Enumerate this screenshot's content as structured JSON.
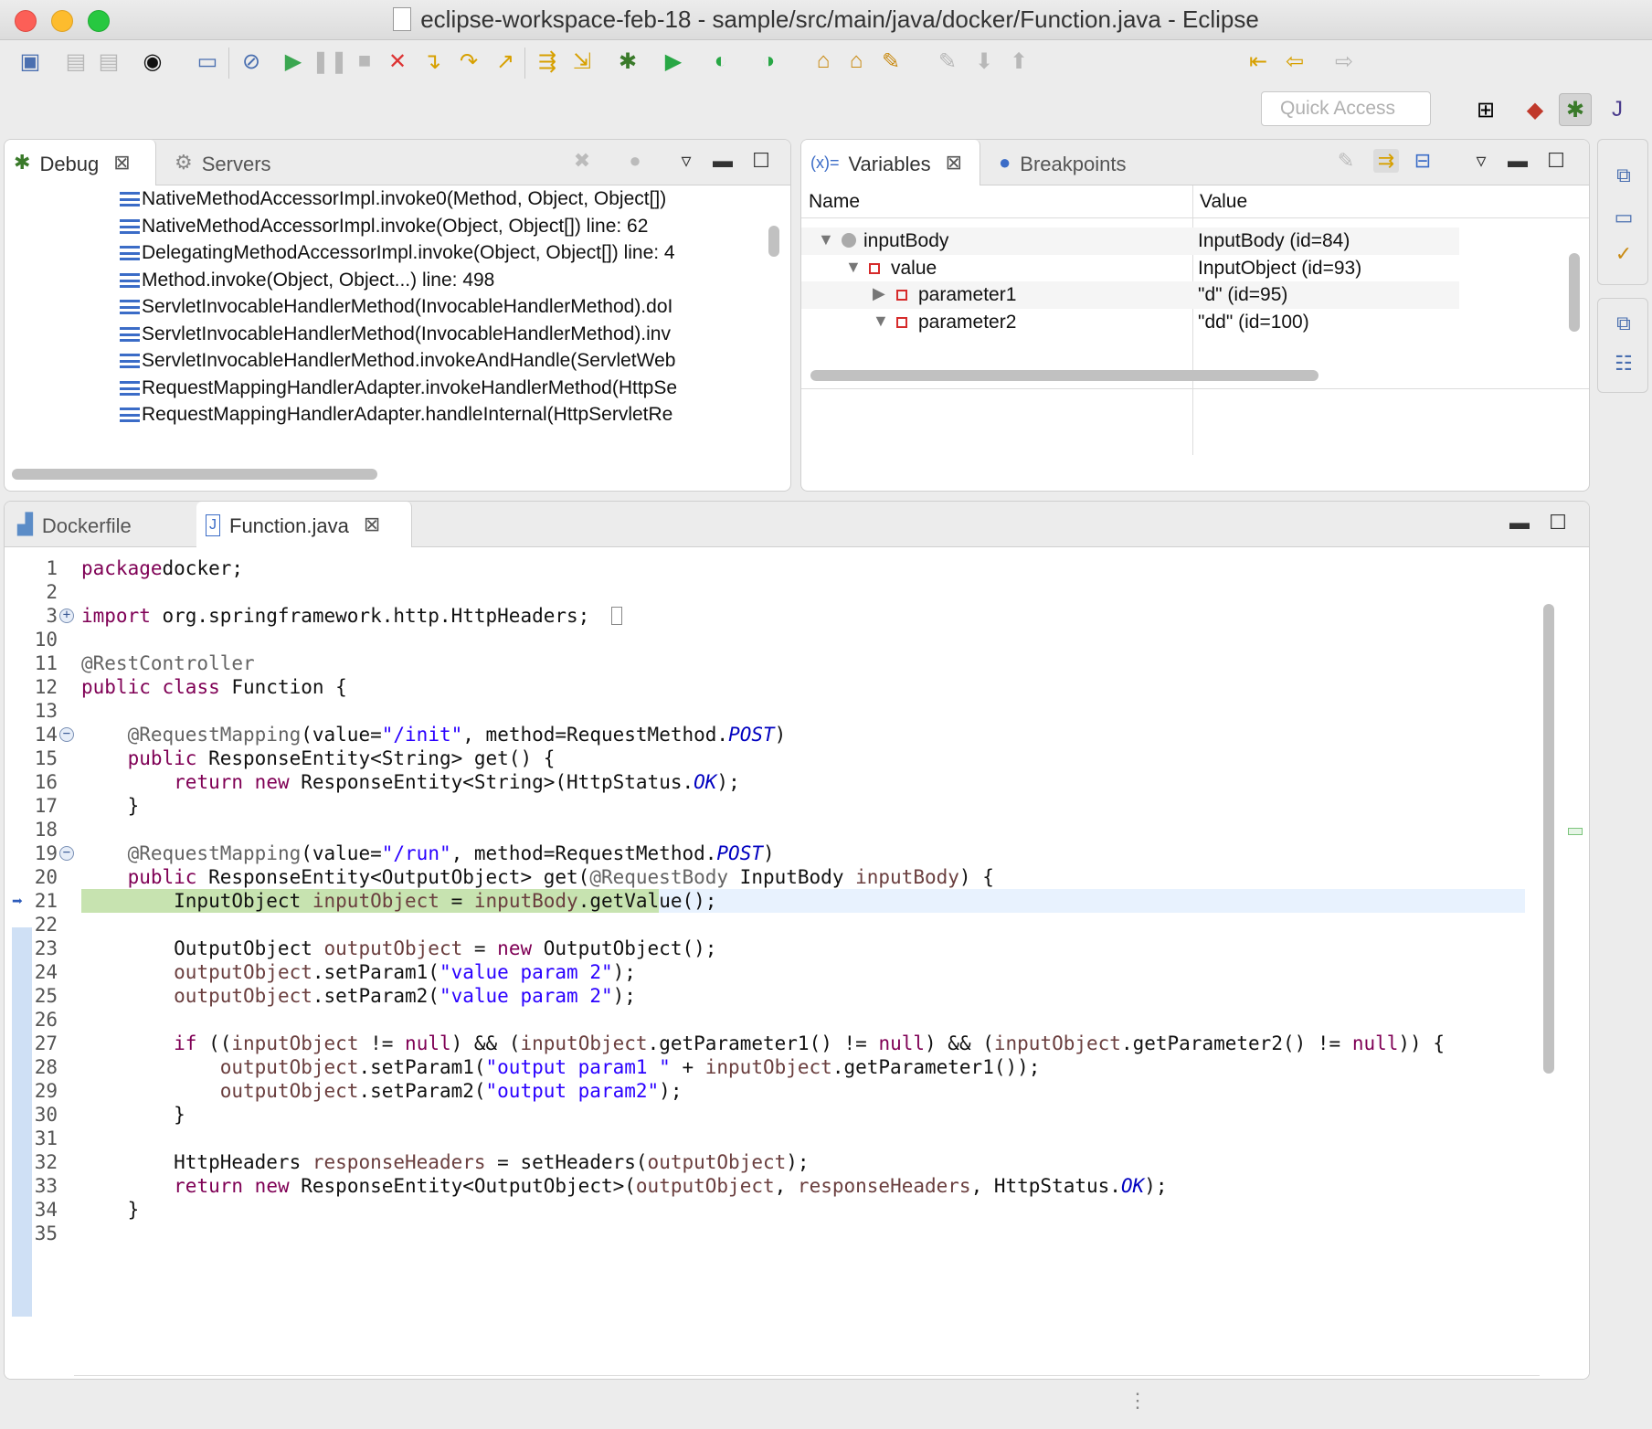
{
  "window": {
    "title": "eclipse-workspace-feb-18 - sample/src/main/java/docker/Function.java - Eclipse"
  },
  "toolbar": {
    "quick_access_placeholder": "Quick Access",
    "icons": [
      "new-wizard-icon",
      "save-icon",
      "save-all-icon",
      "profile-icon",
      "console-icon",
      "skip-breakpoints-icon",
      "resume-icon",
      "suspend-icon",
      "terminate-icon",
      "disconnect-icon",
      "step-into-icon",
      "step-over-icon",
      "step-return-icon",
      "drop-to-frame-icon",
      "use-step-filters-icon",
      "debug-icon",
      "run-icon",
      "coverage-icon",
      "external-tools-icon",
      "open-type-icon",
      "open-task-icon",
      "search-icon",
      "toggle-mark-occurrences-icon",
      "next-annotation-icon",
      "previous-annotation-icon",
      "last-edit-icon",
      "back-icon",
      "forward-icon"
    ],
    "perspectives": [
      "open-perspective-icon",
      "java-ee-perspective-icon",
      "debug-perspective-icon",
      "java-perspective-icon"
    ]
  },
  "debug_view": {
    "tabs": [
      {
        "label": "Debug",
        "icon": "bug-icon",
        "active": true
      },
      {
        "label": "Servers",
        "icon": "servers-icon",
        "active": false
      }
    ],
    "frames": [
      "NativeMethodAccessorImpl.invoke0(Method, Object, Object[])",
      "NativeMethodAccessorImpl.invoke(Object, Object[]) line: 62",
      "DelegatingMethodAccessorImpl.invoke(Object, Object[]) line: 4",
      "Method.invoke(Object, Object...) line: 498",
      "ServletInvocableHandlerMethod(InvocableHandlerMethod).doI",
      "ServletInvocableHandlerMethod(InvocableHandlerMethod).inv",
      "ServletInvocableHandlerMethod.invokeAndHandle(ServletWeb",
      "RequestMappingHandlerAdapter.invokeHandlerMethod(HttpSe",
      "RequestMappingHandlerAdapter.handleInternal(HttpServletRe"
    ]
  },
  "variables_view": {
    "tabs": [
      {
        "label": "Variables",
        "icon": "variables-icon",
        "active": true
      },
      {
        "label": "Breakpoints",
        "icon": "breakpoints-icon",
        "active": false
      }
    ],
    "columns": [
      "Name",
      "Value"
    ],
    "rows": [
      {
        "name": "inputBody",
        "value": "InputBody  (id=84)",
        "expanded": true,
        "icon": "local-variable-icon"
      },
      {
        "name": "value",
        "value": "InputObject  (id=93)",
        "expanded": true,
        "icon": "private-field-icon"
      },
      {
        "name": "parameter1",
        "value": "\"d\" (id=95)",
        "expanded": false,
        "icon": "private-field-icon"
      },
      {
        "name": "parameter2",
        "value": "\"dd\" (id=100)",
        "expanded": true,
        "icon": "private-field-icon"
      }
    ]
  },
  "editor": {
    "tabs": [
      {
        "label": "Dockerfile",
        "icon": "dockerfile-icon",
        "active": false
      },
      {
        "label": "Function.java",
        "icon": "java-file-icon",
        "active": true
      }
    ],
    "current_line": "21",
    "lines": [
      {
        "n": "1",
        "code": [
          [
            "kw",
            "package"
          ],
          [
            "",
            "docker;"
          ]
        ]
      },
      {
        "n": "2",
        "code": []
      },
      {
        "n": "3",
        "code": [
          [
            "kw",
            "import"
          ],
          [
            "",
            " org.springframework.http.HttpHeaders;"
          ]
        ]
      },
      {
        "n": "10",
        "code": []
      },
      {
        "n": "11",
        "code": [
          [
            "ann",
            "@RestController"
          ]
        ]
      },
      {
        "n": "12",
        "code": [
          [
            "kw",
            "public"
          ],
          [
            "",
            " "
          ],
          [
            "kw",
            "class"
          ],
          [
            "",
            " Function {"
          ]
        ]
      },
      {
        "n": "13",
        "code": []
      },
      {
        "n": "14",
        "code": [
          [
            "",
            "    "
          ],
          [
            "ann",
            "@RequestMapping"
          ],
          [
            "",
            "(value="
          ],
          [
            "str",
            "\"/init\""
          ],
          [
            "",
            ", method=RequestMethod."
          ],
          [
            "const",
            "POST"
          ],
          [
            "",
            ")"
          ]
        ]
      },
      {
        "n": "15",
        "code": [
          [
            "",
            "    "
          ],
          [
            "kw",
            "public"
          ],
          [
            "",
            " ResponseEntity<String> get() {"
          ]
        ]
      },
      {
        "n": "16",
        "code": [
          [
            "",
            "        "
          ],
          [
            "kw",
            "return"
          ],
          [
            "",
            " "
          ],
          [
            "kw",
            "new"
          ],
          [
            "",
            " ResponseEntity<String>(HttpStatus."
          ],
          [
            "const",
            "OK"
          ],
          [
            "",
            ");"
          ]
        ]
      },
      {
        "n": "17",
        "code": [
          [
            "",
            "    }"
          ]
        ]
      },
      {
        "n": "18",
        "code": []
      },
      {
        "n": "19",
        "code": [
          [
            "",
            "    "
          ],
          [
            "ann",
            "@RequestMapping"
          ],
          [
            "",
            "(value="
          ],
          [
            "str",
            "\"/run\""
          ],
          [
            "",
            ", method=RequestMethod."
          ],
          [
            "const",
            "POST"
          ],
          [
            "",
            ")"
          ]
        ]
      },
      {
        "n": "20",
        "code": [
          [
            "",
            "    "
          ],
          [
            "kw",
            "public"
          ],
          [
            "",
            " ResponseEntity<OutputObject> get("
          ],
          [
            "ann",
            "@RequestBody"
          ],
          [
            "",
            " InputBody "
          ],
          [
            "var",
            "inputBody"
          ],
          [
            "",
            ") {"
          ]
        ]
      },
      {
        "n": "21",
        "code": [
          [
            "",
            "        InputObject "
          ],
          [
            "var",
            "inputObject"
          ],
          [
            "",
            " = "
          ],
          [
            "var",
            "inputBody"
          ],
          [
            "",
            ".getValue();"
          ]
        ]
      },
      {
        "n": "22",
        "code": []
      },
      {
        "n": "23",
        "code": [
          [
            "",
            "        OutputObject "
          ],
          [
            "var",
            "outputObject"
          ],
          [
            "",
            " = "
          ],
          [
            "kw",
            "new"
          ],
          [
            "",
            " OutputObject();"
          ]
        ]
      },
      {
        "n": "24",
        "code": [
          [
            "",
            "        "
          ],
          [
            "var",
            "outputObject"
          ],
          [
            "",
            ".setParam1("
          ],
          [
            "str",
            "\"value param 2\""
          ],
          [
            "",
            ");"
          ]
        ]
      },
      {
        "n": "25",
        "code": [
          [
            "",
            "        "
          ],
          [
            "var",
            "outputObject"
          ],
          [
            "",
            ".setParam2("
          ],
          [
            "str",
            "\"value param 2\""
          ],
          [
            "",
            ");"
          ]
        ]
      },
      {
        "n": "26",
        "code": []
      },
      {
        "n": "27",
        "code": [
          [
            "",
            "        "
          ],
          [
            "kw",
            "if"
          ],
          [
            "",
            " (("
          ],
          [
            "var",
            "inputObject"
          ],
          [
            "",
            " != "
          ],
          [
            "kw",
            "null"
          ],
          [
            "",
            ") && ("
          ],
          [
            "var",
            "inputObject"
          ],
          [
            "",
            ".getParameter1() != "
          ],
          [
            "kw",
            "null"
          ],
          [
            "",
            ") && ("
          ],
          [
            "var",
            "inputObject"
          ],
          [
            "",
            ".getParameter2() != "
          ],
          [
            "kw",
            "null"
          ],
          [
            "",
            ")) {"
          ]
        ]
      },
      {
        "n": "28",
        "code": [
          [
            "",
            "            "
          ],
          [
            "var",
            "outputObject"
          ],
          [
            "",
            ".setParam1("
          ],
          [
            "str",
            "\"output param1 \""
          ],
          [
            "",
            " + "
          ],
          [
            "var",
            "inputObject"
          ],
          [
            "",
            ".getParameter1());"
          ]
        ]
      },
      {
        "n": "29",
        "code": [
          [
            "",
            "            "
          ],
          [
            "var",
            "outputObject"
          ],
          [
            "",
            ".setParam2("
          ],
          [
            "str",
            "\"output param2\""
          ],
          [
            "",
            ");"
          ]
        ]
      },
      {
        "n": "30",
        "code": [
          [
            "",
            "        }"
          ]
        ]
      },
      {
        "n": "31",
        "code": []
      },
      {
        "n": "32",
        "code": [
          [
            "",
            "        HttpHeaders "
          ],
          [
            "var",
            "responseHeaders"
          ],
          [
            "",
            " = setHeaders("
          ],
          [
            "var",
            "outputObject"
          ],
          [
            "",
            ");"
          ]
        ]
      },
      {
        "n": "33",
        "code": [
          [
            "",
            "        "
          ],
          [
            "kw",
            "return"
          ],
          [
            "",
            " "
          ],
          [
            "kw",
            "new"
          ],
          [
            "",
            " ResponseEntity<OutputObject>("
          ],
          [
            "var",
            "outputObject"
          ],
          [
            "",
            ", "
          ],
          [
            "var",
            "responseHeaders"
          ],
          [
            "",
            ", HttpStatus."
          ],
          [
            "const",
            "OK"
          ],
          [
            "",
            ");"
          ]
        ]
      },
      {
        "n": "34",
        "code": [
          [
            "",
            "    }"
          ]
        ]
      },
      {
        "n": "35",
        "code": []
      }
    ]
  },
  "right_trim": {
    "icons": [
      "restore-icon",
      "console-view-icon",
      "tasks-view-icon",
      "restore-icon",
      "outline-view-icon"
    ]
  }
}
